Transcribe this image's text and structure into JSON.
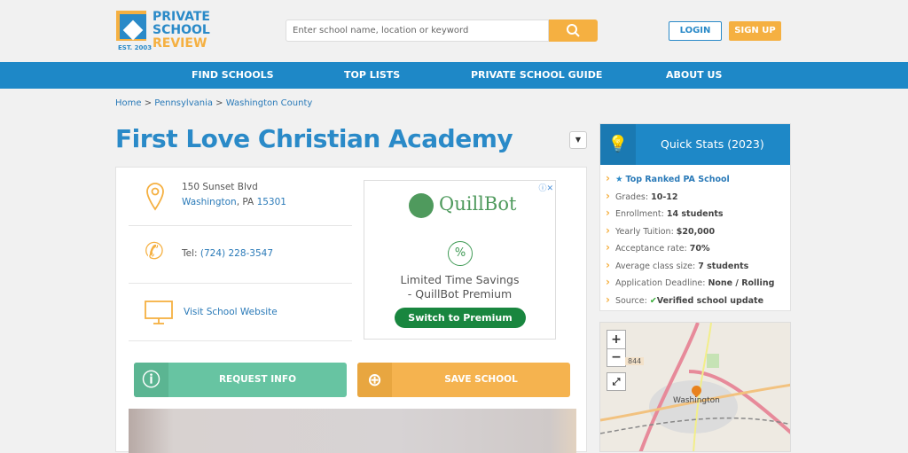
{
  "logo": {
    "line1": "PRIVATE",
    "line2": "SCHOOL",
    "line3": "REVIEW",
    "est": "EST. 2003"
  },
  "search": {
    "placeholder": "Enter school name, location or keyword"
  },
  "header": {
    "login": "LOGIN",
    "signup": "SIGN UP"
  },
  "nav": [
    "FIND SCHOOLS",
    "TOP LISTS",
    "PRIVATE SCHOOL GUIDE",
    "ABOUT US"
  ],
  "breadcrumb": [
    "Home",
    "Pennsylvania",
    "Washington County"
  ],
  "school": {
    "name": "First Love Christian Academy",
    "street": "150 Sunset Blvd",
    "city": "Washington",
    "state_sep": ", PA ",
    "zip": "15301",
    "tel_label": "Tel: ",
    "phone": "(724) 228-3547",
    "website": "Visit School Website"
  },
  "ad": {
    "brand": "QuillBot",
    "headline1": "Limited Time Savings",
    "headline2": "- QuillBot Premium",
    "cta": "Switch to Premium"
  },
  "actions": {
    "request": "REQUEST INFO",
    "save": "SAVE SCHOOL"
  },
  "quick_stats": {
    "title": "Quick Stats (2023)",
    "top_ranked": "Top Ranked PA School",
    "items": [
      {
        "label": "Grades: ",
        "value": "10-12"
      },
      {
        "label": "Enrollment: ",
        "value": "14 students"
      },
      {
        "label": "Yearly Tuition: ",
        "value": "$20,000"
      },
      {
        "label": "Acceptance rate: ",
        "value": "70%"
      },
      {
        "label": "Average class size: ",
        "value": "7 students"
      },
      {
        "label": "Application Deadline: ",
        "value": "None / Rolling"
      }
    ],
    "source_label": "Source: ",
    "source_value": "Verified school update"
  },
  "map": {
    "city": "Washington",
    "zoom_in": "+",
    "zoom_out": "−",
    "route": "844"
  },
  "colors": {
    "brand_blue": "#1e88c7",
    "accent_orange": "#f5b041",
    "green": "#67c4a2"
  }
}
